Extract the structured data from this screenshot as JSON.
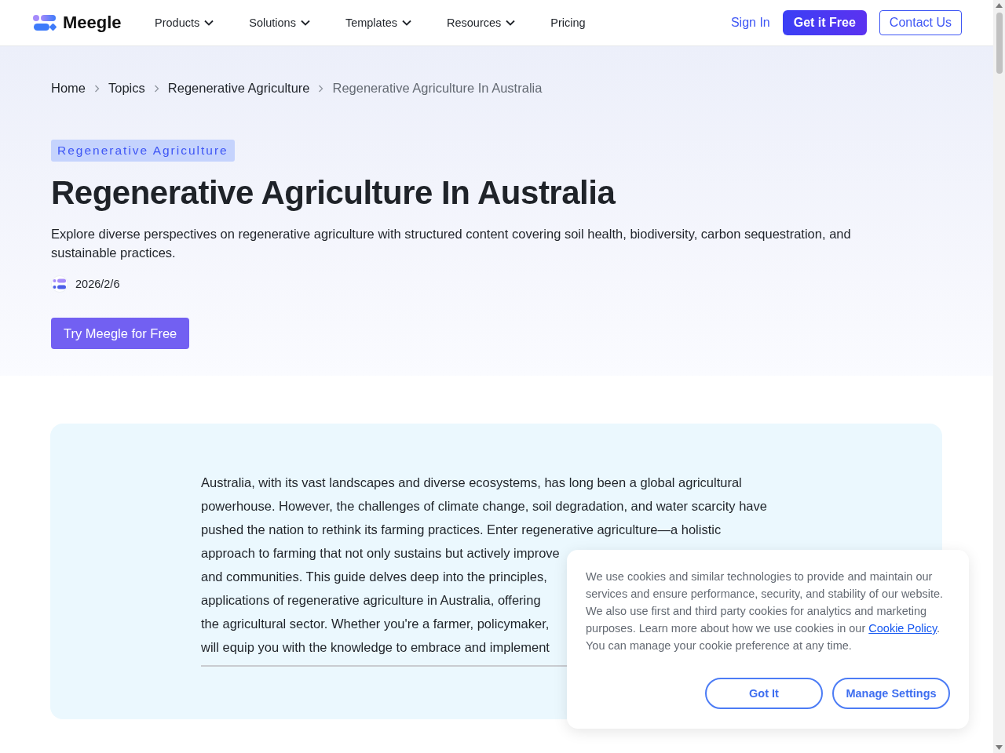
{
  "header": {
    "brand": "Meegle",
    "nav": [
      {
        "label": "Products",
        "dropdown": true
      },
      {
        "label": "Solutions",
        "dropdown": true
      },
      {
        "label": "Templates",
        "dropdown": true
      },
      {
        "label": "Resources",
        "dropdown": true
      },
      {
        "label": "Pricing",
        "dropdown": false
      }
    ],
    "sign_in": "Sign In",
    "get_free": "Get it Free",
    "contact": "Contact Us"
  },
  "breadcrumbs": [
    {
      "label": "Home",
      "current": false
    },
    {
      "label": "Topics",
      "current": false
    },
    {
      "label": "Regenerative Agriculture",
      "current": false
    },
    {
      "label": "Regenerative Agriculture In Australia",
      "current": true
    }
  ],
  "hero": {
    "tag": "Regenerative Agriculture",
    "title": "Regenerative Agriculture In Australia",
    "description": "Explore diverse perspectives on regenerative agriculture with structured content covering soil health, biodiversity, carbon sequestration, and sustainable practices.",
    "date": "2026/2/6",
    "cta": "Try Meegle for Free"
  },
  "intro_lines": [
    "Australia, with its vast landscapes and diverse ecosystems, has long been a global agricultural",
    "powerhouse. However, the challenges of climate change, soil degradation, and water scarcity have",
    "pushed the nation to rethink its farming practices. Enter regenerative agriculture—a holistic",
    "approach to farming that not only sustains but actively improve",
    "and communities. This guide delves deep into the principles,",
    "applications of regenerative agriculture in Australia, offering",
    "the agricultural sector. Whether you're a farmer, policymaker,",
    "will equip you with the knowledge to embrace and implement"
  ],
  "cookie_banner": {
    "text_before": "We use cookies and similar technologies to provide and maintain our services and ensure performance, security, and stability of our website. We also use first and third party cookies for analytics and marketing purposes. Learn more about how we use cookies in our",
    "link": "Cookie Policy",
    "text_after": ". You can manage your cookie preference at any time.",
    "buttons": [
      "Got It",
      "Manage Settings"
    ]
  }
}
